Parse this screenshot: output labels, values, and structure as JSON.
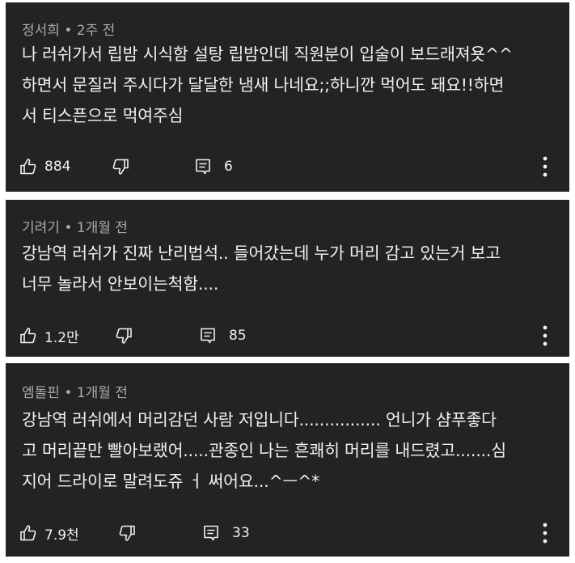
{
  "comments": [
    {
      "author": "정서희",
      "separator": " • ",
      "time": "2주 전",
      "text": "나 러쉬가서 립밤 시식함 설탕 립밤인데 직원분이 입술이 보드래져욧^^\n하면서 문질러 주시다가 달달한 냄새 나네요;;하니깐 먹어도 돼요!!하면\n서 티스픈으로 먹여주심",
      "likes": "884",
      "replies": "6"
    },
    {
      "author": "기려기",
      "separator": " • ",
      "time": "1개월 전",
      "text": "강남역 러쉬가 진짜 난리법석.. 들어갔는데 누가 머리 감고 있는거 보고\n너무 놀라서 안보이는척함....",
      "likes": "1.2만",
      "replies": "85"
    },
    {
      "author": "엠돌핀",
      "separator": " • ",
      "time": "1개월 전",
      "text": "강남역 러쉬에서 머리감던 사람 저입니다................ 언니가 샴푸좋다\n고 머리끝만 빨아보랬어.....관종인 나는 흔쾌히 머리를 내드렸고.......심\n지어 드라이로 말려도쥬 ㅓ 써어요...^ㅡ^*",
      "likes": "7.9천",
      "replies": "33"
    }
  ],
  "icons": {
    "like": "thumbs-up-icon",
    "dislike": "thumbs-down-icon",
    "reply": "reply-icon",
    "more": "more-vert-icon"
  },
  "colors": {
    "card_bg": "#232323",
    "page_bg": "#ffffff",
    "meta_text": "#aaaaaa",
    "body_text": "#f1f1f1"
  }
}
